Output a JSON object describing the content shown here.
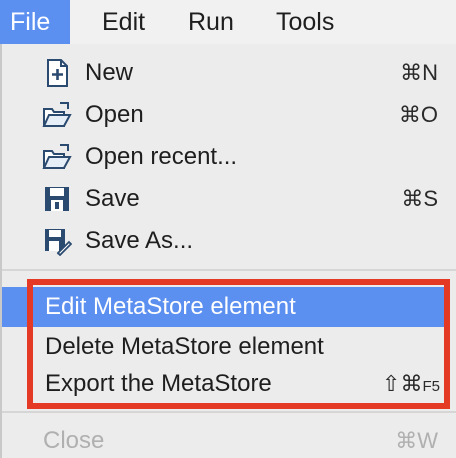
{
  "menubar": {
    "items": [
      {
        "label": "File",
        "active": true
      },
      {
        "label": "Edit",
        "active": false
      },
      {
        "label": "Run",
        "active": false
      },
      {
        "label": "Tools",
        "active": false
      }
    ]
  },
  "file_menu": {
    "items": [
      {
        "label": "New",
        "shortcut": "⌘N",
        "icon": "new-file-icon"
      },
      {
        "label": "Open",
        "shortcut": "⌘O",
        "icon": "open-folder-icon"
      },
      {
        "label": "Open recent...",
        "shortcut": "",
        "icon": "open-recent-icon"
      },
      {
        "label": "Save",
        "shortcut": "⌘S",
        "icon": "save-icon"
      },
      {
        "label": "Save As...",
        "shortcut": "",
        "icon": "save-as-icon"
      }
    ],
    "metastore_items": [
      {
        "label": "Edit MetaStore element",
        "shortcut": "",
        "highlighted": true
      },
      {
        "label": "Delete MetaStore element",
        "shortcut": ""
      },
      {
        "label": "Export the MetaStore",
        "shortcut_main": "⇧⌘",
        "shortcut_key": "F5"
      }
    ],
    "close_item": {
      "label": "Close",
      "shortcut": "⌘W",
      "disabled": true
    }
  },
  "colors": {
    "selection": "#5b8ff0",
    "annotation_frame": "#e43a25",
    "disabled_text": "#b0b0b0"
  }
}
